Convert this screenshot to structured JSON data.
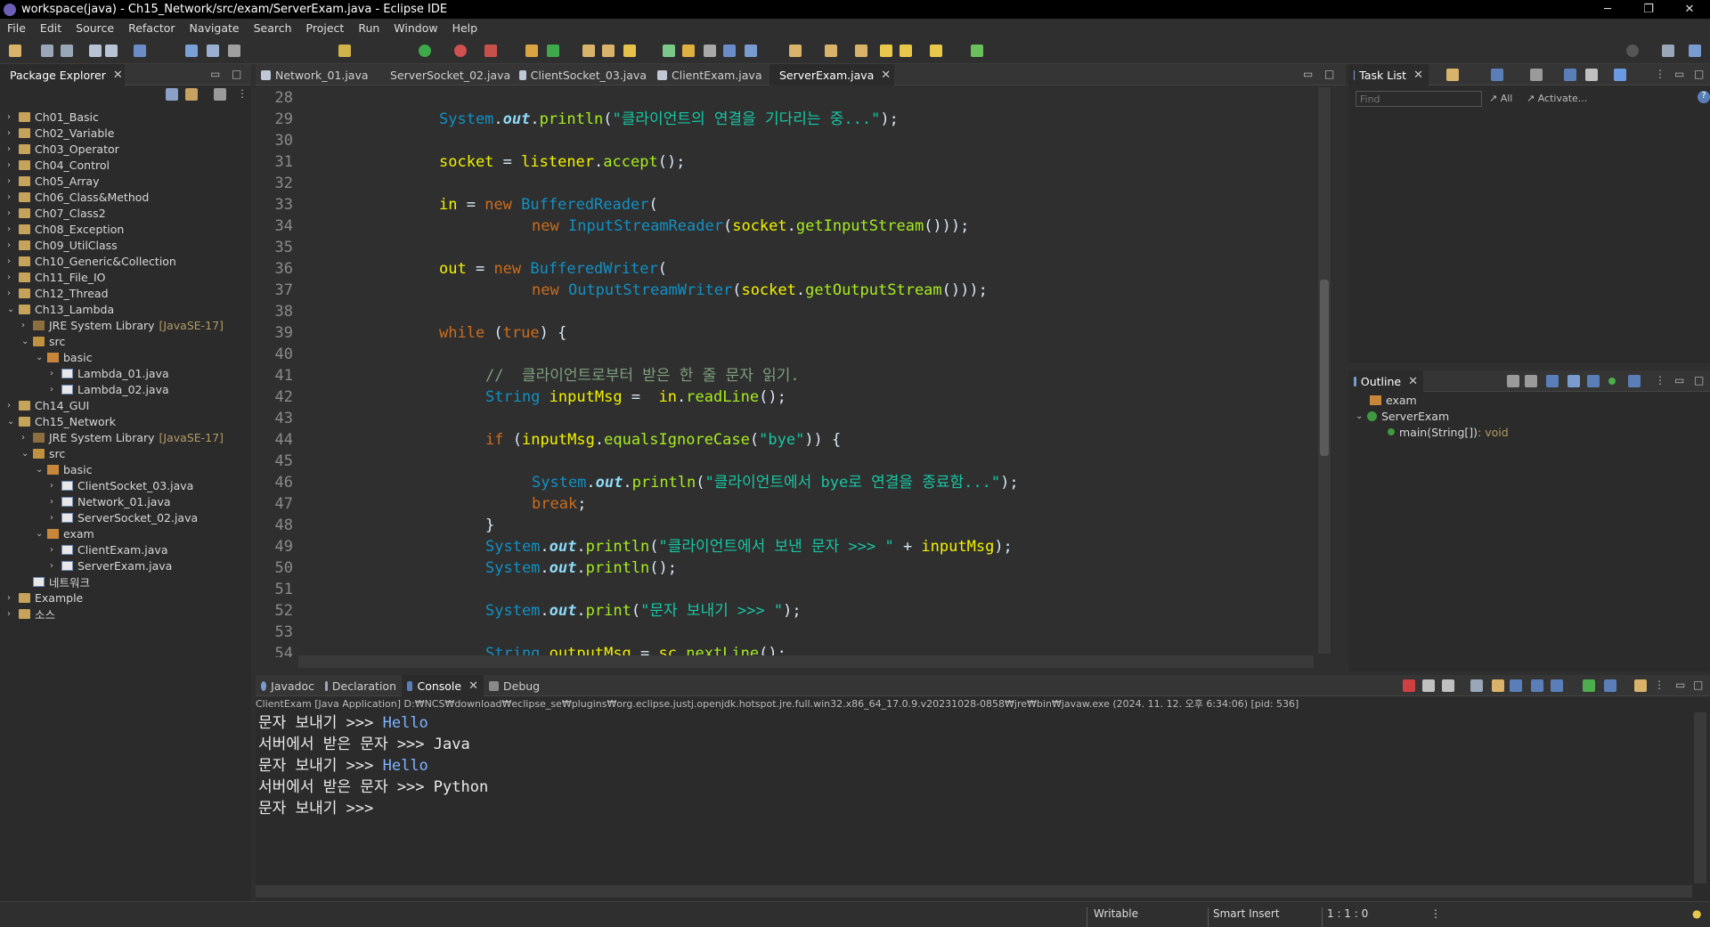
{
  "window": {
    "title": "workspace(java) - Ch15_Network/src/exam/ServerExam.java - Eclipse IDE"
  },
  "menu": [
    "File",
    "Edit",
    "Source",
    "Refactor",
    "Navigate",
    "Search",
    "Project",
    "Run",
    "Window",
    "Help"
  ],
  "package_explorer": {
    "tab": "Package Explorer",
    "items": [
      {
        "label": "Ch01_Basic"
      },
      {
        "label": "Ch02_Variable"
      },
      {
        "label": "Ch03_Operator"
      },
      {
        "label": "Ch04_Control"
      },
      {
        "label": "Ch05_Array"
      },
      {
        "label": "Ch06_Class&Method"
      },
      {
        "label": "Ch07_Class2"
      },
      {
        "label": "Ch08_Exception"
      },
      {
        "label": "Ch09_UtilClass"
      },
      {
        "label": "Ch10_Generic&Collection"
      },
      {
        "label": "Ch11_File_IO"
      },
      {
        "label": "Ch12_Thread"
      },
      {
        "label": "Ch13_Lambda"
      },
      {
        "label": "JRE System Library",
        "deco": "[JavaSE-17]"
      },
      {
        "label": "src"
      },
      {
        "label": "basic"
      },
      {
        "label": "Lambda_01.java"
      },
      {
        "label": "Lambda_02.java"
      },
      {
        "label": "Ch14_GUI"
      },
      {
        "label": "Ch15_Network"
      },
      {
        "label": "JRE System Library",
        "deco": "[JavaSE-17]"
      },
      {
        "label": "src"
      },
      {
        "label": "basic"
      },
      {
        "label": "ClientSocket_03.java"
      },
      {
        "label": "Network_01.java"
      },
      {
        "label": "ServerSocket_02.java"
      },
      {
        "label": "exam"
      },
      {
        "label": "ClientExam.java"
      },
      {
        "label": "ServerExam.java"
      },
      {
        "label": "네트워크"
      },
      {
        "label": "Example"
      },
      {
        "label": "소스"
      }
    ]
  },
  "editor_tabs": [
    "Network_01.java",
    "ServerSocket_02.java",
    "ClientSocket_03.java",
    "ClientExam.java",
    "ServerExam.java"
  ],
  "code_lines": [
    "28",
    "29",
    "30",
    "31",
    "32",
    "33",
    "34",
    "35",
    "36",
    "37",
    "38",
    "39",
    "40",
    "41",
    "42",
    "43",
    "44",
    "45",
    "46",
    "47",
    "48",
    "49",
    "50",
    "51",
    "52",
    "53",
    "54"
  ],
  "code": {
    "l29_str": "\"클라이언트의 연결을 기다리는 중...\"",
    "l41_cmt": "//  클라이언트로부터 받은 한 줄 문자 읽기.",
    "l44_str": "\"bye\"",
    "l46_str": "\"클라이언트에서 bye로 연결을 종료함...\"",
    "l49_str": "\"클라이언트에서 보낸 문자 >>> \"",
    "l52_str": "\"문자 보내기 >>> \""
  },
  "task_list": {
    "tab": "Task List",
    "find_placeholder": "Find",
    "all": "All",
    "activate": "Activate..."
  },
  "outline": {
    "tab": "Outline",
    "pkg": "exam",
    "cls": "ServerExam",
    "method": "main(String[])",
    "method_type": " : void"
  },
  "bottom_tabs": [
    "Javadoc",
    "Declaration",
    "Console",
    "Debug"
  ],
  "console": {
    "header": "ClientExam [Java Application] D:₩NCS₩download₩eclipse_se₩plugins₩org.eclipse.justj.openjdk.hotspot.jre.full.win32.x86_64_17.0.9.v20231028-0858₩jre₩bin₩javaw.exe  (2024. 11. 12. 오후 6:34:06) [pid: 536]",
    "lines": [
      {
        "prompt": "문자 보내기 >>> ",
        "input": "Hello"
      },
      {
        "prompt": "서버에서 받은 문자 >>> Java",
        "input": ""
      },
      {
        "prompt": "문자 보내기 >>> ",
        "input": "Hello"
      },
      {
        "prompt": "서버에서 받은 문자 >>> Python",
        "input": ""
      },
      {
        "prompt": "문자 보내기 >>> ",
        "input": ""
      }
    ]
  },
  "status": {
    "writable": "Writable",
    "insert": "Smart Insert",
    "position": "1 : 1 : 0"
  }
}
